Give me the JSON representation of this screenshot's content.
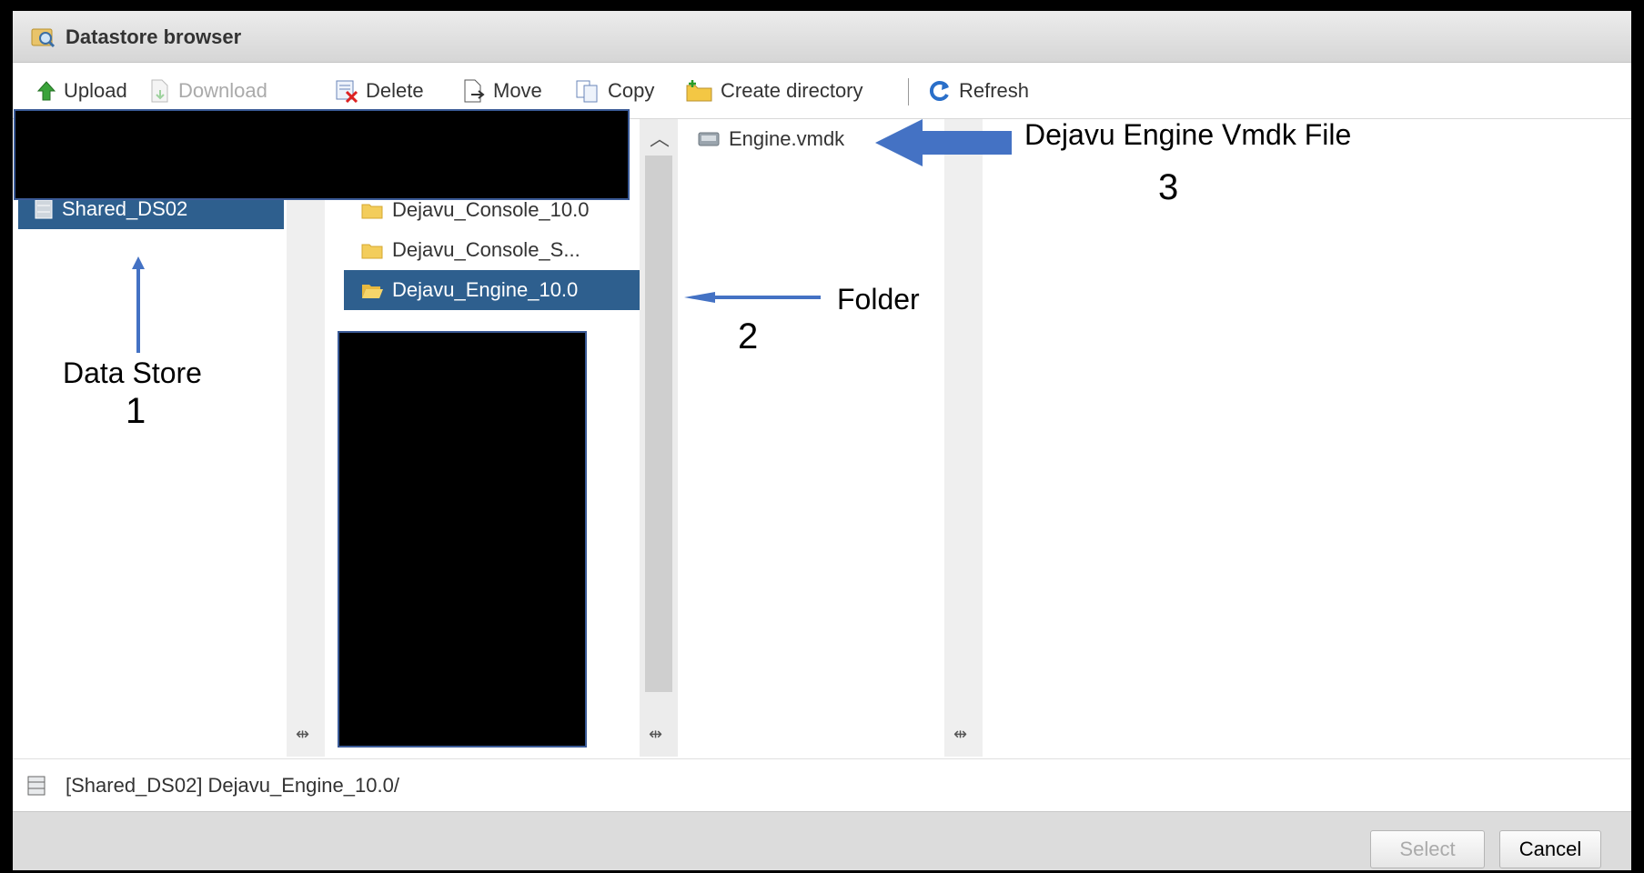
{
  "window": {
    "title": "Datastore browser"
  },
  "toolbar": {
    "upload": "Upload",
    "download": "Download",
    "delete": "Delete",
    "move": "Move",
    "copy": "Copy",
    "create_directory": "Create directory",
    "refresh": "Refresh"
  },
  "datastores": [
    {
      "label": "Shared_DS02",
      "selected": true
    }
  ],
  "folders": [
    {
      "label": "Dejavu_Console_10.0",
      "selected": false
    },
    {
      "label": "Dejavu_Console_S...",
      "selected": false
    },
    {
      "label": "Dejavu_Engine_10.0",
      "selected": true
    }
  ],
  "files": [
    {
      "label": "Engine.vmdk"
    }
  ],
  "status": {
    "path": "[Shared_DS02] Dejavu_Engine_10.0/"
  },
  "buttons": {
    "select": "Select",
    "cancel": "Cancel"
  },
  "annotations": {
    "datastore_label": "Data Store",
    "datastore_number": "1",
    "folder_label": "Folder",
    "folder_number": "2",
    "file_label": "Dejavu  Engine Vmdk File",
    "file_number": "3"
  },
  "colors": {
    "selection": "#2e5f8e",
    "arrow": "#4472c4"
  }
}
